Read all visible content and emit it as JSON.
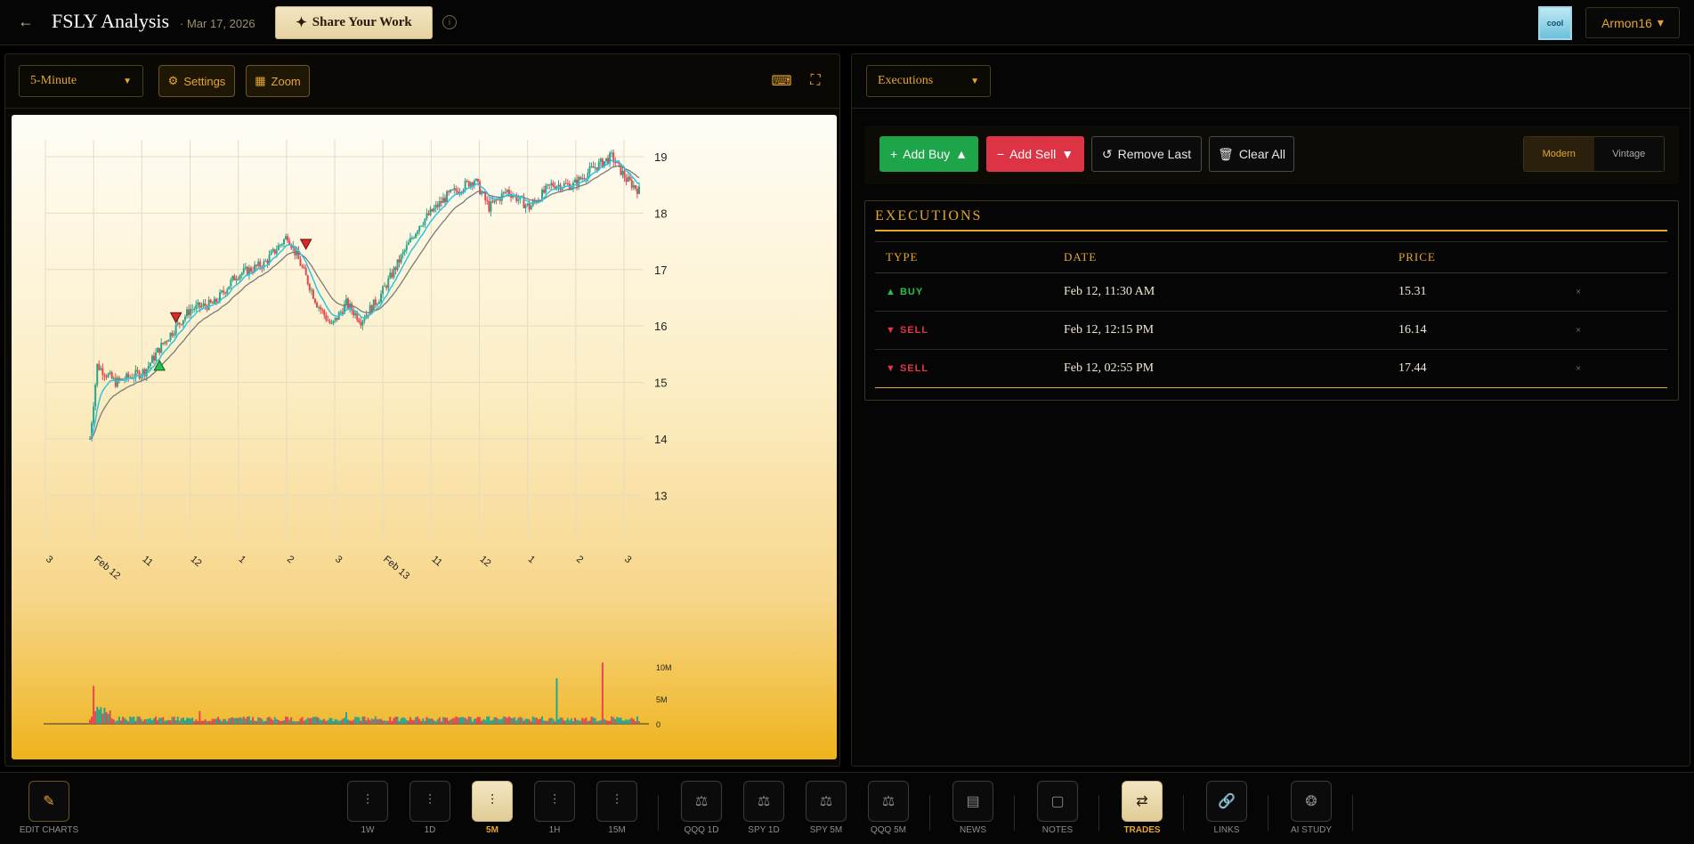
{
  "header": {
    "title": "FSLY Analysis",
    "date": "· Mar 17, 2026",
    "share_label": "Share Your Work",
    "avatar_text": "cool",
    "user_name": "Armon16"
  },
  "left_toolbar": {
    "interval_value": "5-Minute",
    "settings_label": "Settings",
    "zoom_label": "Zoom"
  },
  "right_toolbar": {
    "view_value": "Executions"
  },
  "actions": {
    "add_buy": "Add Buy",
    "add_sell": "Add Sell",
    "remove_last": "Remove Last",
    "clear_all": "Clear All",
    "mode_modern": "Modern",
    "mode_vintage": "Vintage"
  },
  "executions": {
    "title": "EXECUTIONS",
    "columns": [
      "TYPE",
      "DATE",
      "PRICE"
    ],
    "rows": [
      {
        "type": "▲ BUY",
        "kind": "buy",
        "date": "Feb 12, 11:30 AM",
        "price": "15.31"
      },
      {
        "type": "▼ SELL",
        "kind": "sell",
        "date": "Feb 12, 12:15 PM",
        "price": "16.14"
      },
      {
        "type": "▼ SELL",
        "kind": "sell",
        "date": "Feb 12, 02:55 PM",
        "price": "17.44"
      }
    ],
    "delete_glyph": "×"
  },
  "bottom_nav": {
    "edit_charts": "EDIT CHARTS",
    "items": [
      "1W",
      "1D",
      "5M",
      "1H",
      "15M",
      "QQQ 1D",
      "SPY 1D",
      "SPY 5M",
      "QQQ 5M",
      "NEWS",
      "NOTES",
      "TRADES",
      "LINKS",
      "AI STUDY"
    ]
  },
  "chart_data": {
    "type": "candlestick",
    "symbol": "FSLY",
    "interval": "5-Minute",
    "y_ticks": [
      13,
      14,
      15,
      16,
      17,
      18,
      19
    ],
    "ylim": [
      12.2,
      19.3
    ],
    "x_ticks": [
      "3",
      "Feb 12",
      "11",
      "12",
      "1",
      "2",
      "3",
      "Feb 13",
      "11",
      "12",
      "1",
      "2",
      "3"
    ],
    "volume_ticks": [
      "10M",
      "5M",
      "0"
    ],
    "close_path": [
      {
        "t": 0,
        "v": 14.0
      },
      {
        "t": 4,
        "v": 15.3
      },
      {
        "t": 14,
        "v": 15.0
      },
      {
        "t": 22,
        "v": 15.1
      },
      {
        "t": 30,
        "v": 15.2
      },
      {
        "t": 38,
        "v": 15.6
      },
      {
        "t": 45,
        "v": 15.9
      },
      {
        "t": 55,
        "v": 16.3
      },
      {
        "t": 68,
        "v": 16.4
      },
      {
        "t": 80,
        "v": 16.9
      },
      {
        "t": 95,
        "v": 17.1
      },
      {
        "t": 108,
        "v": 17.6
      },
      {
        "t": 115,
        "v": 17.1
      },
      {
        "t": 124,
        "v": 16.4
      },
      {
        "t": 132,
        "v": 16.0
      },
      {
        "t": 140,
        "v": 16.4
      },
      {
        "t": 148,
        "v": 16.1
      },
      {
        "t": 158,
        "v": 16.5
      },
      {
        "t": 168,
        "v": 17.1
      },
      {
        "t": 180,
        "v": 17.8
      },
      {
        "t": 195,
        "v": 18.3
      },
      {
        "t": 210,
        "v": 18.6
      },
      {
        "t": 218,
        "v": 18.1
      },
      {
        "t": 228,
        "v": 18.4
      },
      {
        "t": 240,
        "v": 18.1
      },
      {
        "t": 252,
        "v": 18.5
      },
      {
        "t": 264,
        "v": 18.5
      },
      {
        "t": 275,
        "v": 18.8
      },
      {
        "t": 285,
        "v": 19.0
      },
      {
        "t": 293,
        "v": 18.6
      },
      {
        "t": 300,
        "v": 18.4
      }
    ],
    "markers": [
      {
        "type": "buy",
        "t": 38,
        "price": 15.31
      },
      {
        "type": "sell",
        "t": 47,
        "price": 16.14
      },
      {
        "type": "sell",
        "t": 118,
        "price": 17.44
      }
    ],
    "colors": {
      "up": "#2aa58c",
      "down": "#e5484d",
      "ema_fast": "#2ec3e6",
      "ema_slow": "#7a7a7a",
      "buy": "#27c24b",
      "sell": "#d62b2b"
    }
  }
}
